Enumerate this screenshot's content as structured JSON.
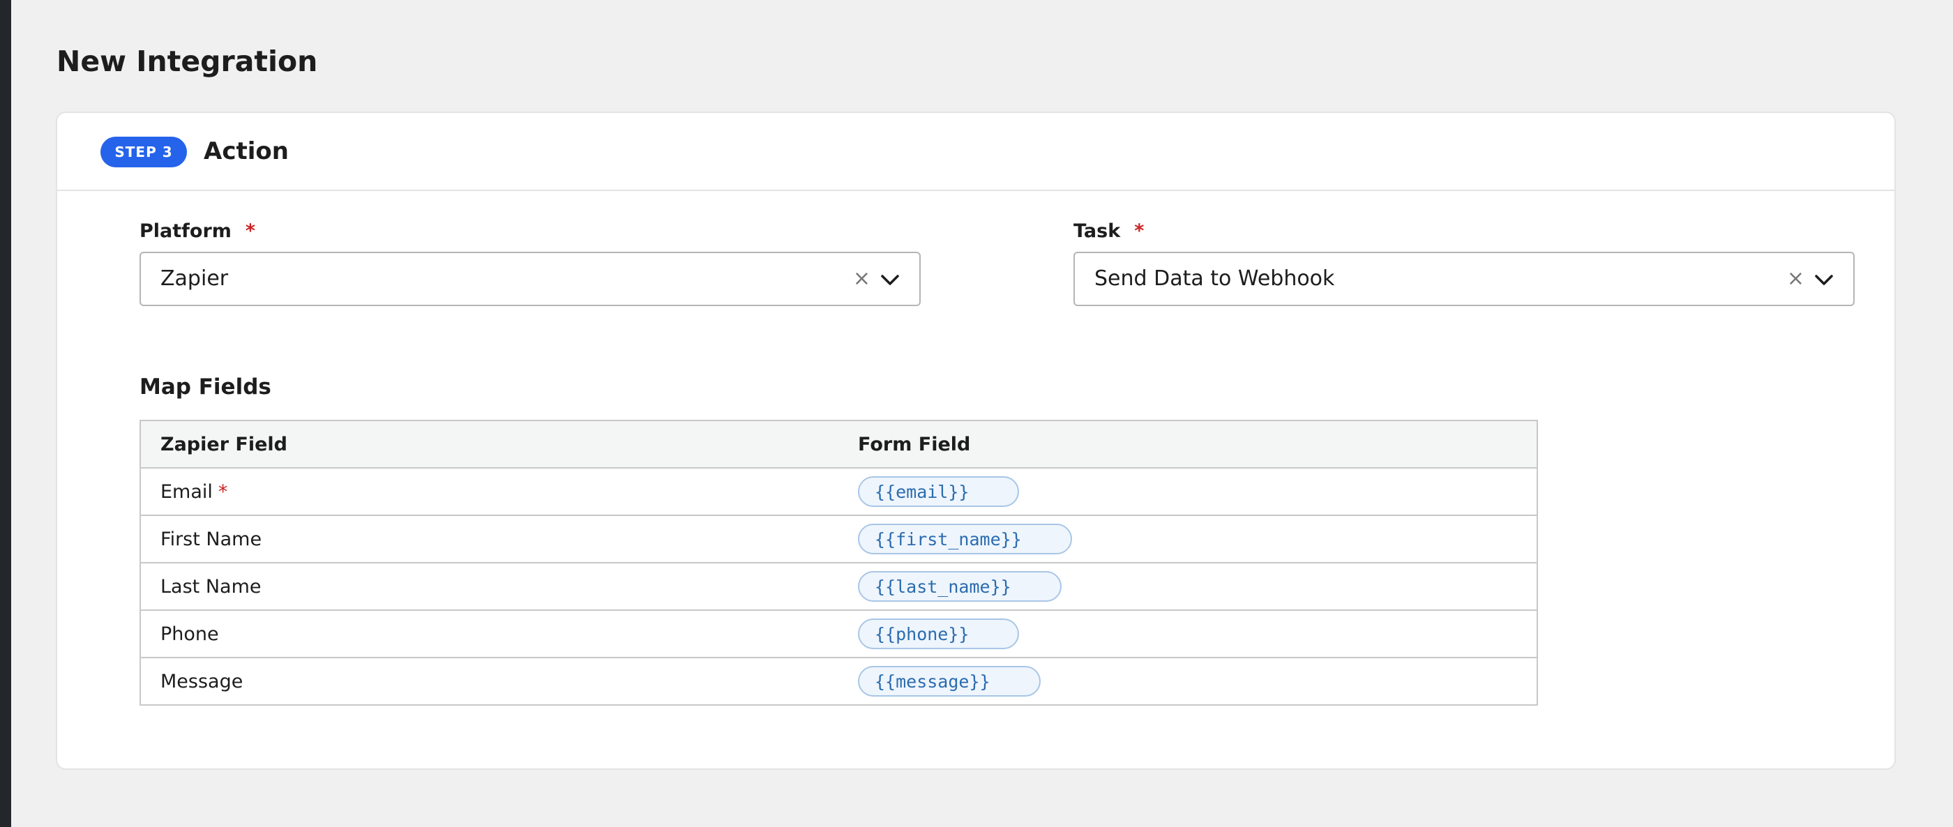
{
  "page": {
    "title": "New Integration"
  },
  "step": {
    "badge": "STEP 3",
    "title": "Action"
  },
  "platform": {
    "label": "Platform",
    "required_mark": "*",
    "value": "Zapier",
    "clear_glyph": "×"
  },
  "task": {
    "label": "Task",
    "required_mark": "*",
    "value": "Send Data to Webhook",
    "clear_glyph": "×"
  },
  "map_fields": {
    "title": "Map Fields",
    "columns": [
      "Zapier Field",
      "Form Field"
    ],
    "rows": [
      {
        "field": "Email",
        "required": "*",
        "token": "{{email}}"
      },
      {
        "field": "First Name",
        "required": "",
        "token": "{{first_name}}"
      },
      {
        "field": "Last Name",
        "required": "",
        "token": "{{last_name}}"
      },
      {
        "field": "Phone",
        "required": "",
        "token": "{{phone}}"
      },
      {
        "field": "Message",
        "required": "",
        "token": "{{message}}"
      }
    ]
  },
  "colors": {
    "accent": "#2563eb",
    "required": "#cc2222",
    "token_text": "#2b6cb0",
    "token_bg": "#eef5fc"
  },
  "icons": {
    "clear": "close-icon",
    "dropdown": "chevron-down-icon"
  }
}
